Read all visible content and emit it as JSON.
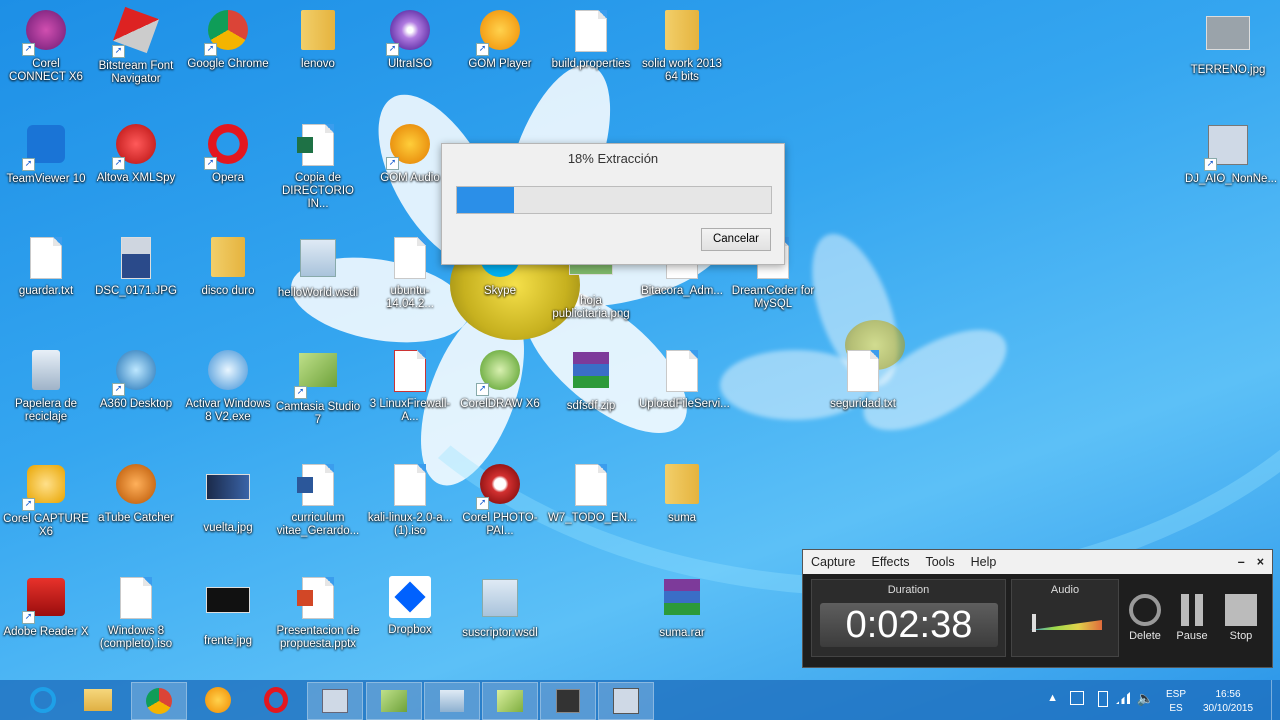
{
  "desktop_icons": [
    {
      "id": "corel-connect",
      "label": "Corel CONNECT X6",
      "x": 0
    },
    {
      "id": "bitstream",
      "label": "Bitstream Font Navigator"
    },
    {
      "id": "chrome",
      "label": "Google Chrome"
    },
    {
      "id": "lenovo",
      "label": "lenovo"
    },
    {
      "id": "ultraiso",
      "label": "UltraISO"
    },
    {
      "id": "gomplayer",
      "label": "GOM Player"
    },
    {
      "id": "build",
      "label": "build.properties"
    },
    {
      "id": "solidwork",
      "label": "solid work 2013 64 bits"
    },
    {
      "id": "terreno",
      "label": "TERRENO.jpg"
    },
    {
      "id": "teamviewer",
      "label": "TeamViewer 10"
    },
    {
      "id": "xmlspy",
      "label": "Altova XMLSpy"
    },
    {
      "id": "opera",
      "label": "Opera"
    },
    {
      "id": "copia",
      "label": "Copia de DIRECTORIO IN..."
    },
    {
      "id": "gomaudio",
      "label": "GOM Audio"
    },
    {
      "id": "djaio",
      "label": "DJ_AIO_NonNe..."
    },
    {
      "id": "guardar",
      "label": "guardar.txt"
    },
    {
      "id": "dsc",
      "label": "DSC_0171.JPG"
    },
    {
      "id": "disco",
      "label": "disco duro"
    },
    {
      "id": "helloworld",
      "label": "helloWorld.wsdl"
    },
    {
      "id": "ubuntu",
      "label": "ubuntu-14.04.2..."
    },
    {
      "id": "skype",
      "label": "Skype"
    },
    {
      "id": "hoja",
      "label": "hoja publicitaria.png"
    },
    {
      "id": "bitacora",
      "label": "Bitacora_Adm..."
    },
    {
      "id": "dreamcoder",
      "label": "DreamCoder for MySQL"
    },
    {
      "id": "papelera",
      "label": "Papelera de reciclaje"
    },
    {
      "id": "a360",
      "label": "A360 Desktop"
    },
    {
      "id": "activar",
      "label": "Activar Windows 8 V2.exe"
    },
    {
      "id": "camtasia",
      "label": "Camtasia Studio 7"
    },
    {
      "id": "linuxfw",
      "label": "3 LinuxFirewall-A..."
    },
    {
      "id": "coreldraw",
      "label": "CorelDRAW X6"
    },
    {
      "id": "sdfsdf",
      "label": "sdfsdf.zip"
    },
    {
      "id": "upload",
      "label": "UploadFileServi..."
    },
    {
      "id": "seguridad",
      "label": "seguridad.txt"
    },
    {
      "id": "corelcapture",
      "label": "Corel CAPTURE X6"
    },
    {
      "id": "atube",
      "label": "aTube Catcher"
    },
    {
      "id": "vuelta",
      "label": "vuelta.jpg"
    },
    {
      "id": "curriculum",
      "label": "curriculum vitae_Gerardo..."
    },
    {
      "id": "kali",
      "label": "kali-linux-2.0-a... (1).iso"
    },
    {
      "id": "photopaint",
      "label": "Corel PHOTO-PAI..."
    },
    {
      "id": "w7",
      "label": "W7_TODO_EN..."
    },
    {
      "id": "suma",
      "label": "suma"
    },
    {
      "id": "adobe",
      "label": "Adobe Reader X"
    },
    {
      "id": "win8",
      "label": "Windows 8 (completo).iso"
    },
    {
      "id": "frente",
      "label": "frente.jpg"
    },
    {
      "id": "presentacion",
      "label": "Presentacion de propuesta.pptx"
    },
    {
      "id": "dropbox",
      "label": "Dropbox"
    },
    {
      "id": "suscriptor",
      "label": "suscriptor.wsdl"
    },
    {
      "id": "sumarar",
      "label": "suma.rar"
    }
  ],
  "dialog": {
    "title": "18% Extracción",
    "progress_percent": 18,
    "cancel_label": "Cancelar"
  },
  "recorder": {
    "menu": [
      "Capture",
      "Effects",
      "Tools",
      "Help"
    ],
    "minimize": "–",
    "close": "×",
    "duration_label": "Duration",
    "duration_value": "0:02:38",
    "audio_label": "Audio",
    "delete_label": "Delete",
    "pause_label": "Pause",
    "stop_label": "Stop"
  },
  "taskbar": {
    "apps": [
      "ie-icon",
      "explorer-icon",
      "chrome-icon",
      "gomplayer-icon",
      "opera-icon",
      "xmlspy-icon",
      "camtasia-icon",
      "altova-icon",
      "camtasia-recorder-icon",
      "film-icon",
      "djaio-icon"
    ]
  },
  "tray": {
    "lang_top": "ESP",
    "lang_bottom": "ES",
    "time": "16:56",
    "date": "30/10/2015"
  },
  "colors": {
    "desktop": "#2b9de9",
    "progress": "#2b8fe8",
    "recorder": "#1e1e1e"
  }
}
